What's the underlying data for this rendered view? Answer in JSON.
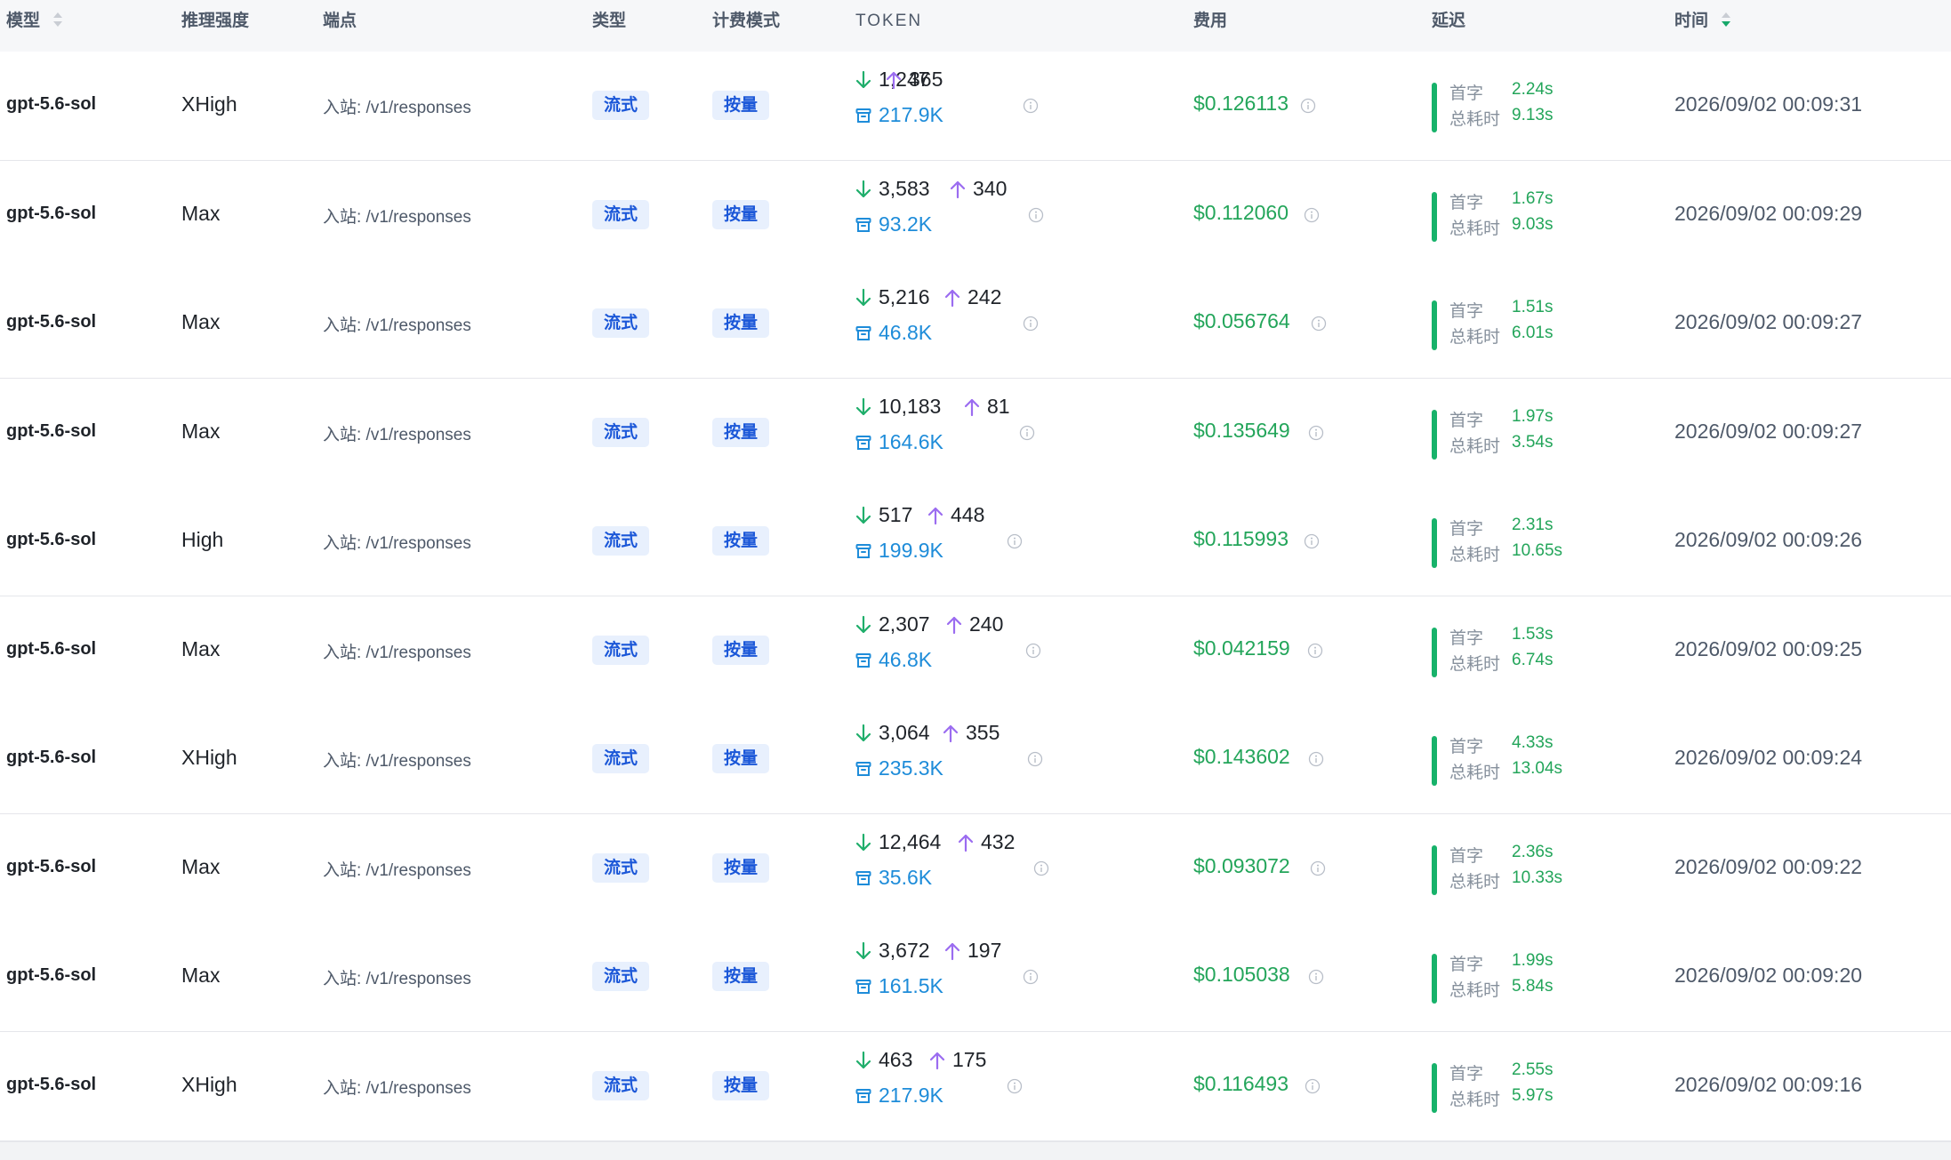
{
  "columns": {
    "model": "模型",
    "effort": "推理强度",
    "endpoint": "端点",
    "type": "类型",
    "billing": "计费模式",
    "token": "TOKEN",
    "cost": "费用",
    "latency": "延迟",
    "time": "时间"
  },
  "latency_labels": {
    "first": "首字",
    "total": "总耗时"
  },
  "icons": {
    "input_tokens": "arrow-down-icon",
    "output_tokens": "arrow-up-icon",
    "cache_tokens": "archive-box-icon",
    "info": "info-circle-icon",
    "sort": "sort-caret-icon"
  },
  "colors": {
    "cost_green": "#23a55a",
    "cache_blue": "#1e8cd9",
    "arrow_green": "#1fae6b",
    "arrow_purple": "#9b6cf0",
    "tag_bg": "#e8f0fd",
    "tag_text": "#1b57d8",
    "latency_bar": "#17b26a"
  },
  "rows": [
    {
      "model": "gpt-5.6-sol",
      "effort": "XHigh",
      "endpoint": "入站: /v1/responses",
      "type": "流式",
      "billing": "按量",
      "tokens_in": "1,247",
      "tokens_out": "365",
      "tokens_cache": "217.9K",
      "cost": "$0.126113",
      "first_token": "2.24s",
      "total_time": "9.13s",
      "time": "2026/09/02 00:09:31"
    },
    {
      "model": "gpt-5.6-sol",
      "effort": "Max",
      "endpoint": "入站: /v1/responses",
      "type": "流式",
      "billing": "按量",
      "tokens_in": "3,583",
      "tokens_out": "340",
      "tokens_cache": "93.2K",
      "cost": "$0.112060",
      "first_token": "1.67s",
      "total_time": "9.03s",
      "time": "2026/09/02 00:09:29"
    },
    {
      "model": "gpt-5.6-sol",
      "effort": "Max",
      "endpoint": "入站: /v1/responses",
      "type": "流式",
      "billing": "按量",
      "tokens_in": "5,216",
      "tokens_out": "242",
      "tokens_cache": "46.8K",
      "cost": "$0.056764",
      "first_token": "1.51s",
      "total_time": "6.01s",
      "time": "2026/09/02 00:09:27"
    },
    {
      "model": "gpt-5.6-sol",
      "effort": "Max",
      "endpoint": "入站: /v1/responses",
      "type": "流式",
      "billing": "按量",
      "tokens_in": "10,183",
      "tokens_out": "81",
      "tokens_cache": "164.6K",
      "cost": "$0.135649",
      "first_token": "1.97s",
      "total_time": "3.54s",
      "time": "2026/09/02 00:09:27"
    },
    {
      "model": "gpt-5.6-sol",
      "effort": "High",
      "endpoint": "入站: /v1/responses",
      "type": "流式",
      "billing": "按量",
      "tokens_in": "517",
      "tokens_out": "448",
      "tokens_cache": "199.9K",
      "cost": "$0.115993",
      "first_token": "2.31s",
      "total_time": "10.65s",
      "time": "2026/09/02 00:09:26"
    },
    {
      "model": "gpt-5.6-sol",
      "effort": "Max",
      "endpoint": "入站: /v1/responses",
      "type": "流式",
      "billing": "按量",
      "tokens_in": "2,307",
      "tokens_out": "240",
      "tokens_cache": "46.8K",
      "cost": "$0.042159",
      "first_token": "1.53s",
      "total_time": "6.74s",
      "time": "2026/09/02 00:09:25"
    },
    {
      "model": "gpt-5.6-sol",
      "effort": "XHigh",
      "endpoint": "入站: /v1/responses",
      "type": "流式",
      "billing": "按量",
      "tokens_in": "3,064",
      "tokens_out": "355",
      "tokens_cache": "235.3K",
      "cost": "$0.143602",
      "first_token": "4.33s",
      "total_time": "13.04s",
      "time": "2026/09/02 00:09:24"
    },
    {
      "model": "gpt-5.6-sol",
      "effort": "Max",
      "endpoint": "入站: /v1/responses",
      "type": "流式",
      "billing": "按量",
      "tokens_in": "12,464",
      "tokens_out": "432",
      "tokens_cache": "35.6K",
      "cost": "$0.093072",
      "first_token": "2.36s",
      "total_time": "10.33s",
      "time": "2026/09/02 00:09:22"
    },
    {
      "model": "gpt-5.6-sol",
      "effort": "Max",
      "endpoint": "入站: /v1/responses",
      "type": "流式",
      "billing": "按量",
      "tokens_in": "3,672",
      "tokens_out": "197",
      "tokens_cache": "161.5K",
      "cost": "$0.105038",
      "first_token": "1.99s",
      "total_time": "5.84s",
      "time": "2026/09/02 00:09:20"
    },
    {
      "model": "gpt-5.6-sol",
      "effort": "XHigh",
      "endpoint": "入站: /v1/responses",
      "type": "流式",
      "billing": "按量",
      "tokens_in": "463",
      "tokens_out": "175",
      "tokens_cache": "217.9K",
      "cost": "$0.116493",
      "first_token": "2.55s",
      "total_time": "5.97s",
      "time": "2026/09/02 00:09:16"
    }
  ]
}
